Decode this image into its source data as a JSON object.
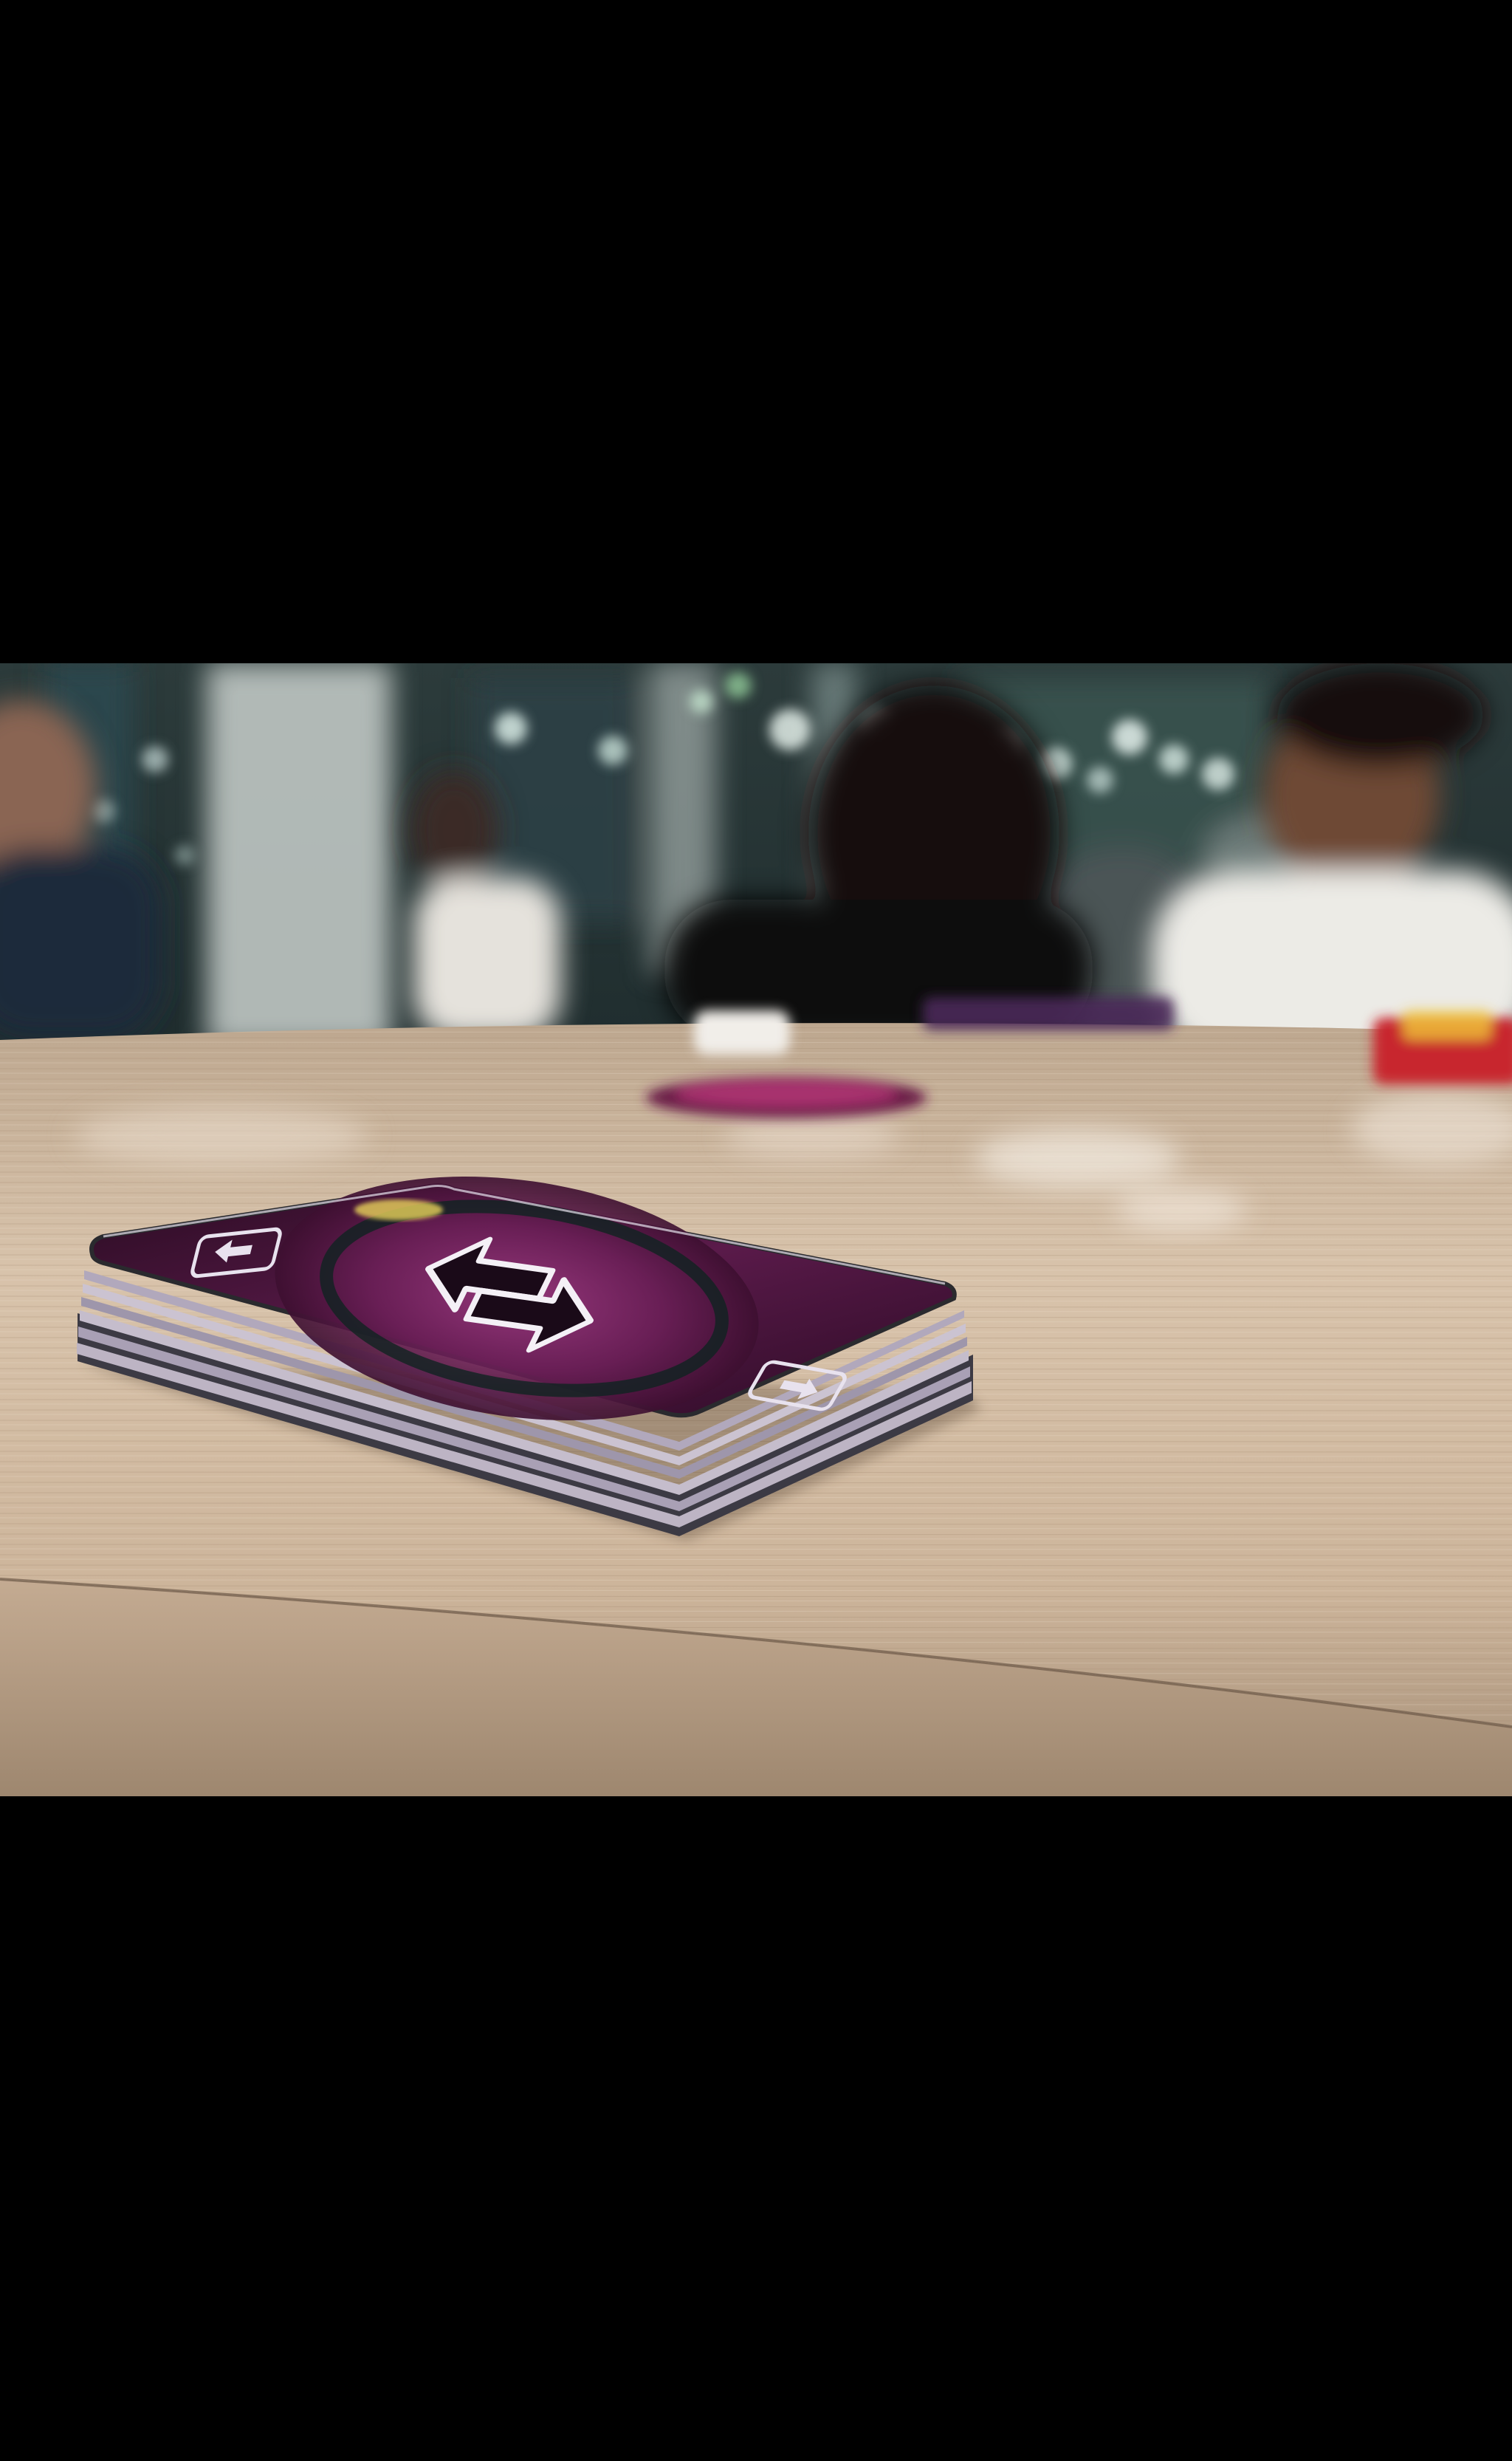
{
  "photo": {
    "subject": "stack-of-cards-on-table",
    "card_icon": "reverse-arrow-icon",
    "colors": {
      "card_back": "#4a1238",
      "card_glow": "#8a2e72",
      "card_edge": "#b7aebd",
      "table": "#d9c2aa",
      "table_dark": "#a48b73",
      "background": "#1c2a2c"
    }
  }
}
